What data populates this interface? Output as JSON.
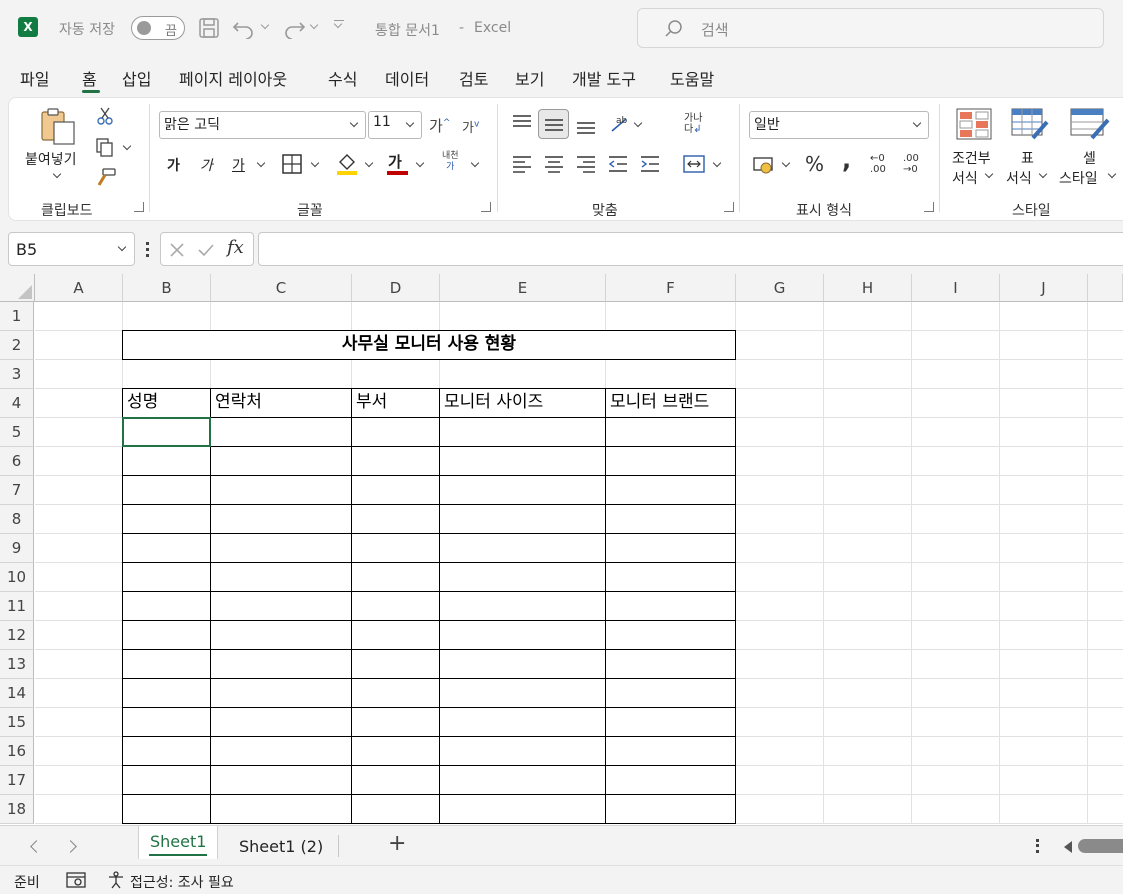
{
  "titlebar": {
    "autosave_label": "자동 저장",
    "autosave_state": "끔",
    "doc_title": "통합 문서1",
    "separator": "-",
    "app_name": "Excel",
    "search_placeholder": "검색"
  },
  "menu": {
    "tabs": [
      "파일",
      "홈",
      "삽입",
      "페이지 레이아웃",
      "수식",
      "데이터",
      "검토",
      "보기",
      "개발 도구",
      "도움말"
    ],
    "active": "홈"
  },
  "ribbon": {
    "clipboard": {
      "paste_label": "붙여넣기",
      "group_label": "클립보드"
    },
    "font": {
      "font_name": "맑은 고딕",
      "font_size": "11",
      "group_label": "글꼴",
      "bold": "가",
      "italic": "가",
      "underline": "가",
      "color_glyph": "가",
      "grow_glyph": "가",
      "shrink_glyph": "가",
      "phonetic_top": "내천",
      "phonetic_bottom": "가"
    },
    "alignment": {
      "group_label": "맞춤",
      "wrap_top": "가나",
      "wrap_bottom": "다"
    },
    "number": {
      "format": "일반",
      "group_label": "표시 형식",
      "percent": "%",
      "comma": ",",
      "inc_decimal": "←0 .00",
      "dec_decimal": ".00 →0"
    },
    "styles": {
      "group_label": "스타일",
      "conditional_line1": "조건부",
      "conditional_line2": "서식",
      "table_line1": "표",
      "table_line2": "서식",
      "cell_line1": "셀",
      "cell_line2": "스타일"
    },
    "colors": {
      "accent": "#217346",
      "font_color": "#c00000",
      "fill_color": "#ffd200"
    }
  },
  "formula_bar": {
    "cell_ref": "B5",
    "fx": "fx",
    "value": ""
  },
  "sheet": {
    "columns": [
      "A",
      "B",
      "C",
      "D",
      "E",
      "F",
      "G",
      "H",
      "I",
      "J"
    ],
    "rows": [
      "1",
      "2",
      "3",
      "4",
      "5",
      "6",
      "7",
      "8",
      "9",
      "10",
      "11",
      "12",
      "13",
      "14",
      "15",
      "16",
      "17",
      "18"
    ],
    "title": "사무실 모니터 사용 현황",
    "headers": [
      "성명",
      "연락처",
      "부서",
      "모니터 사이즈",
      "모니터 브랜드"
    ]
  },
  "tabs": {
    "sheets": [
      "Sheet1",
      "Sheet1 (2)"
    ],
    "active": "Sheet1",
    "add": "+"
  },
  "status": {
    "ready": "준비",
    "accessibility": "접근성: 조사 필요"
  }
}
